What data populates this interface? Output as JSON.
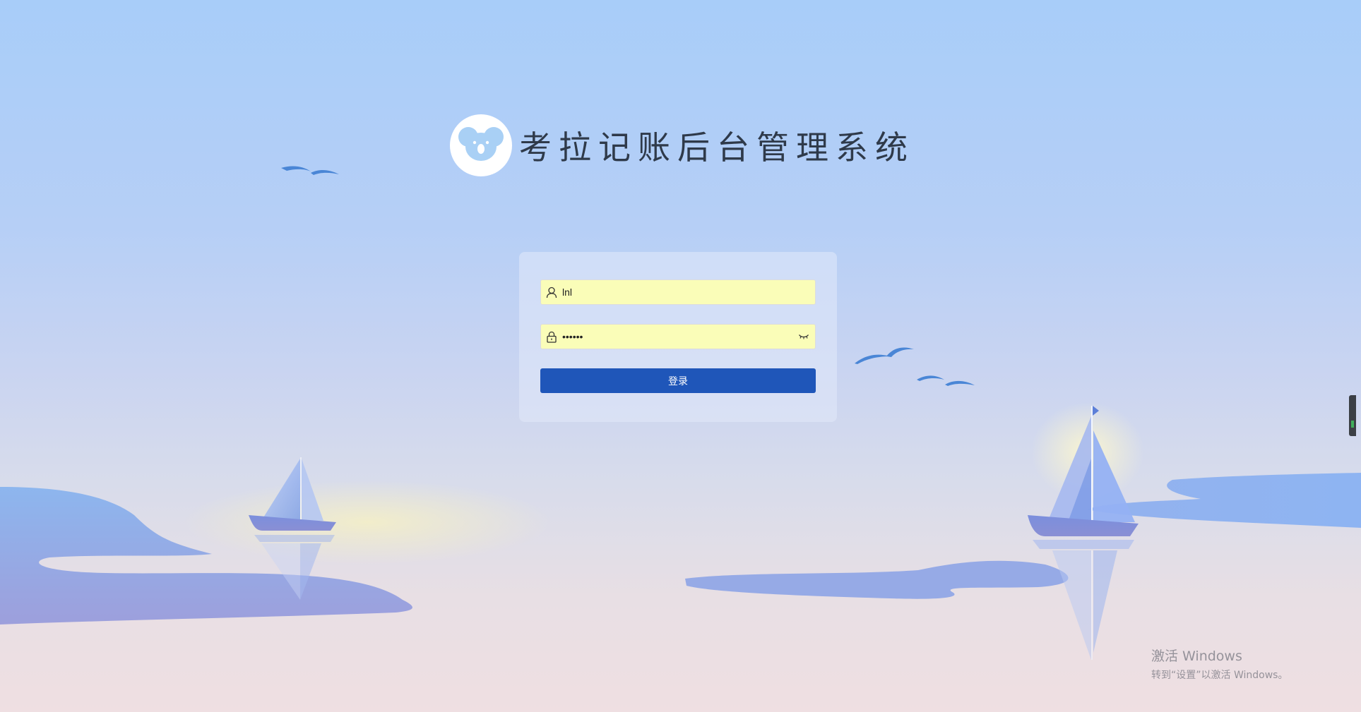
{
  "app": {
    "title": "考拉记账后台管理系统",
    "logo_icon": "koala-icon"
  },
  "login": {
    "username_value": "lnl",
    "username_icon": "user-icon",
    "password_value": "123456",
    "password_icon": "lock-icon",
    "toggle_icon": "eye-closed-icon",
    "submit_label": "登录"
  },
  "watermark": {
    "title": "激活 Windows",
    "subtitle": "转到“设置”以激活 Windows。"
  },
  "colors": {
    "primary_button": "#1f56b9",
    "autofill_bg": "#fafdb8",
    "title_text": "#2f3a4a"
  }
}
